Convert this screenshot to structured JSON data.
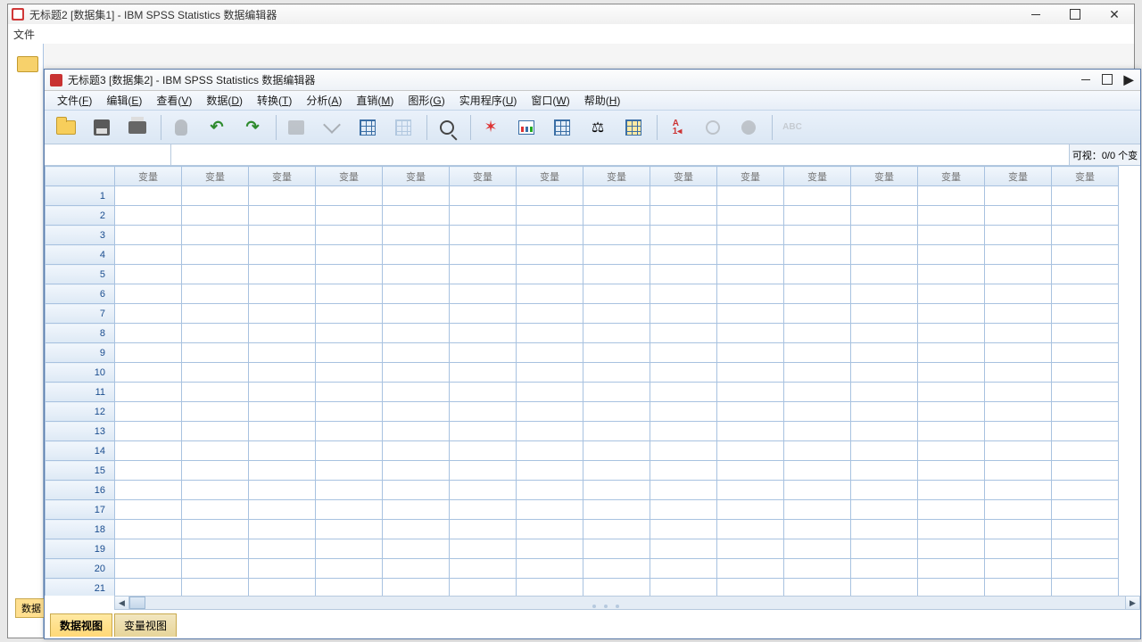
{
  "outer": {
    "title": "无标题2  [数据集1] - IBM SPSS Statistics 数据编辑器",
    "menu_first": "文件"
  },
  "inner": {
    "title": "无标题3  [数据集2] - IBM SPSS Statistics 数据编辑器"
  },
  "menu": [
    {
      "label": "文件",
      "key": "F"
    },
    {
      "label": "编辑",
      "key": "E"
    },
    {
      "label": "查看",
      "key": "V"
    },
    {
      "label": "数据",
      "key": "D"
    },
    {
      "label": "转换",
      "key": "T"
    },
    {
      "label": "分析",
      "key": "A"
    },
    {
      "label": "直销",
      "key": "M"
    },
    {
      "label": "图形",
      "key": "G"
    },
    {
      "label": "实用程序",
      "key": "U"
    },
    {
      "label": "窗口",
      "key": "W"
    },
    {
      "label": "帮助",
      "key": "H"
    }
  ],
  "visibility": {
    "label": "可视：",
    "value": "0/0 个变"
  },
  "column_header": "变量",
  "columns": 15,
  "rows": 22,
  "tabs": {
    "data_view": "数据视图",
    "variable_view": "变量视图"
  },
  "back_tab": "数据"
}
